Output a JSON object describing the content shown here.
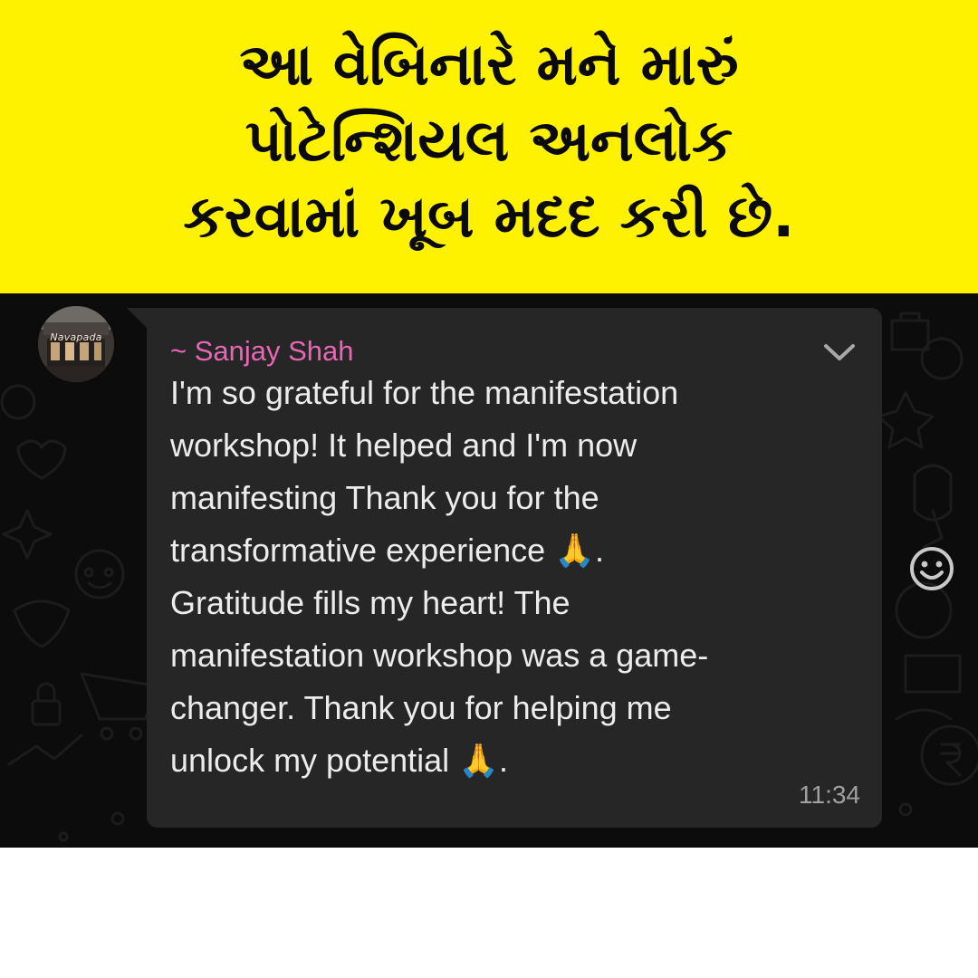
{
  "banner": {
    "lines": [
      "આ વેબિનારે મને મારું",
      "પોટેન્શિયલ અનલોક",
      "કરવામાં ખૂબ મદદ કરી છે."
    ]
  },
  "avatar": {
    "label": "Navapada"
  },
  "message": {
    "sender": "~ Sanjay Shah",
    "lines": [
      "I'm so grateful for the manifestation",
      "workshop! It helped and I'm now",
      "manifesting Thank you for the",
      "transformative experience 🙏.",
      "Gratitude fills my heart! The",
      "manifestation workshop was a game-",
      "changer. Thank you for helping me",
      "unlock my potential 🙏."
    ],
    "time": "11:34"
  },
  "icons": {
    "menu": "chevron-down-icon",
    "emoji": "emoji-smiley-icon"
  },
  "colors": {
    "banner": "#fff200",
    "chat_bg": "#0c0c0c",
    "bubble": "#262626",
    "sender": "#e667b4",
    "text": "#ececec",
    "time": "#a0a0a0"
  }
}
